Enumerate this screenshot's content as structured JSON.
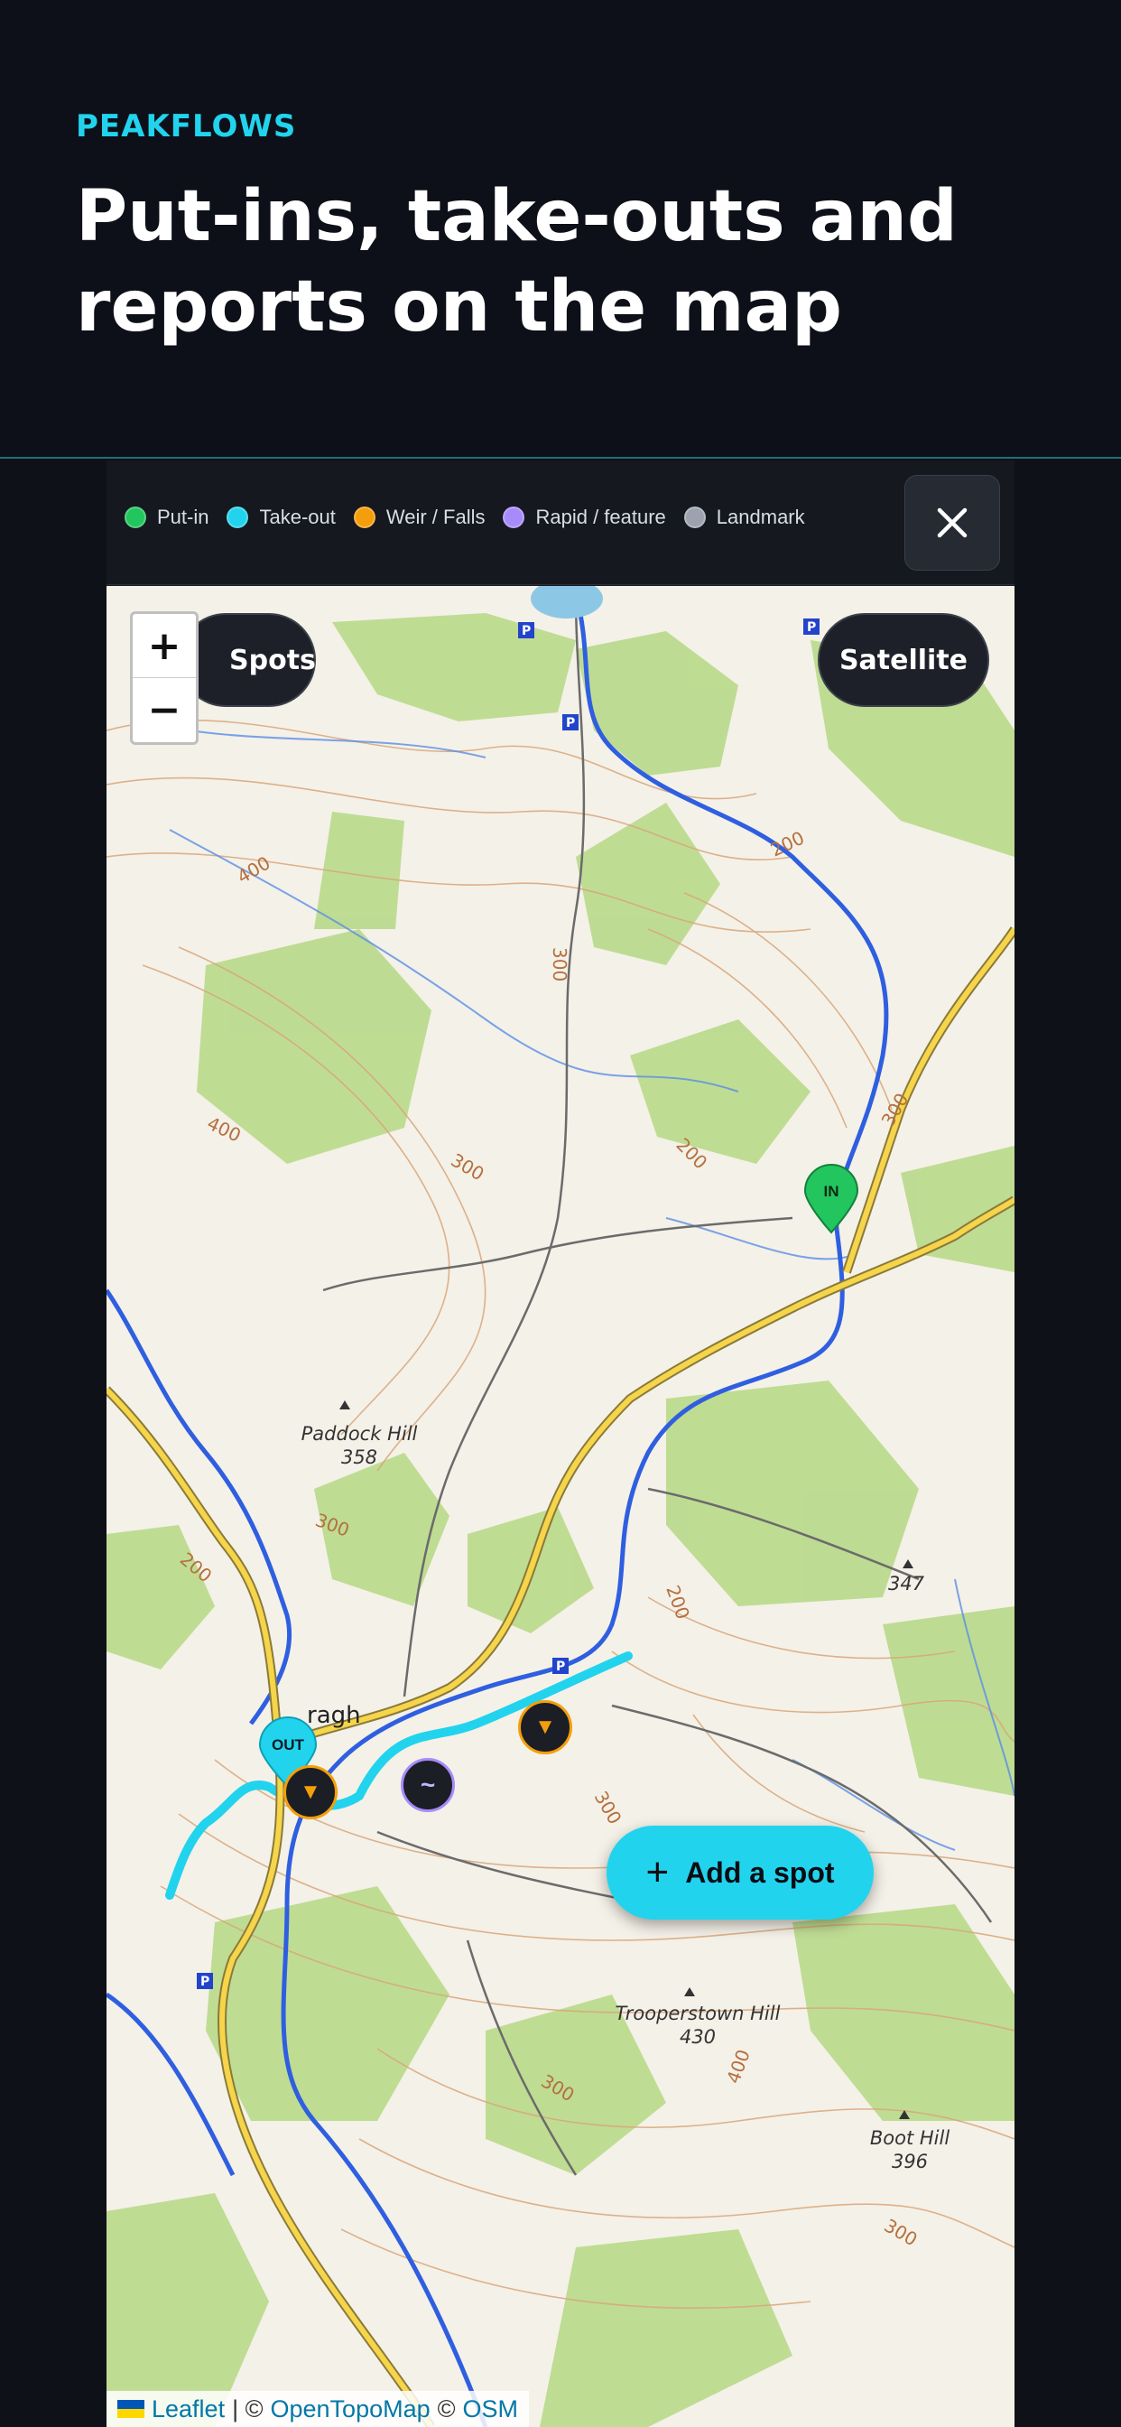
{
  "hero": {
    "brand": "PEAKFLOWS",
    "headline_line1": "Put-ins, take-outs and",
    "headline_line2": "reports on the map"
  },
  "legend": {
    "items": [
      {
        "label": "Put-in",
        "color": "#22c55e"
      },
      {
        "label": "Take-out",
        "color": "#22d3ee"
      },
      {
        "label": "Weir / Falls",
        "color": "#f59e0b"
      },
      {
        "label": "Rapid / feature",
        "color": "#a78bfa"
      },
      {
        "label": "Landmark",
        "color": "#9ca3af"
      }
    ],
    "close_icon": "close-icon"
  },
  "map": {
    "spots_label": "Spots",
    "satellite_label": "Satellite",
    "zoom_in": "+",
    "zoom_out": "−",
    "markers": {
      "put_in": "IN",
      "take_out": "OUT",
      "weir_glyph": "▼",
      "rapid_glyph": "~"
    },
    "place_labels": {
      "paddock_hill_name": "Paddock Hill",
      "paddock_hill_elev": "358",
      "trooperstown_name": "Trooperstown Hill",
      "trooperstown_elev": "430",
      "boot_hill_name": "Boot Hill",
      "boot_hill_elev": "396",
      "spot_height": "347",
      "town_partial": "ragh"
    },
    "contour_labels": [
      "400",
      "300",
      "300",
      "200",
      "300",
      "400",
      "200",
      "200",
      "300",
      "300",
      "200",
      "300",
      "400",
      "300"
    ],
    "attribution": {
      "leaflet": "Leaflet",
      "sep1": "| ©",
      "opentopomap": "OpenTopoMap",
      "sep2": "©",
      "osm": "OSM"
    }
  },
  "add_button": {
    "label": "Add a spot",
    "icon": "plus-icon"
  },
  "colors": {
    "accent": "#22d3ee",
    "background": "#0e1118",
    "put_in": "#22c55e",
    "weir": "#f59e0b",
    "rapid": "#a78bfa"
  }
}
